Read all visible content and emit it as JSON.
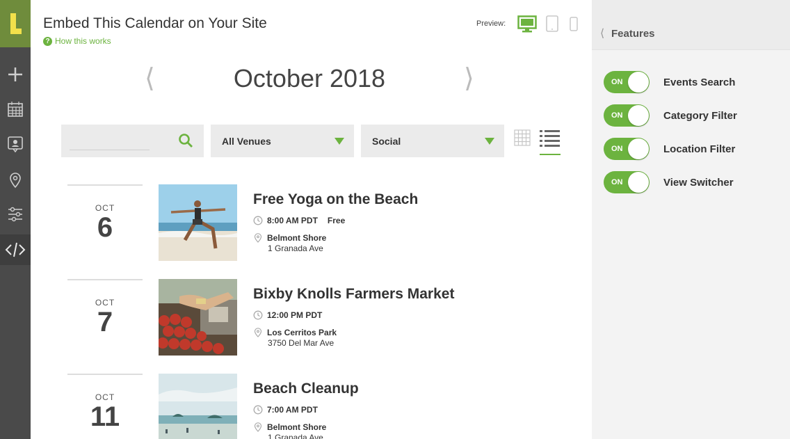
{
  "header": {
    "title": "Embed This Calendar on Your Site",
    "help_link": "How this works",
    "help_icon": "?",
    "preview_label": "Preview:"
  },
  "calendar": {
    "month_label": "October 2018",
    "prev_arrow": "⟨",
    "next_arrow": "⟩"
  },
  "filters": {
    "search_value": "",
    "venue_selected": "All Venues",
    "category_selected": "Social"
  },
  "events": [
    {
      "month": "OCT",
      "day": "6",
      "name": "Free Yoga on the Beach",
      "time": "8:00 AM PDT",
      "price": "Free",
      "venue": "Belmont Shore",
      "address": "1 Granada Ave"
    },
    {
      "month": "OCT",
      "day": "7",
      "name": "Bixby Knolls Farmers Market",
      "time": "12:00 PM PDT",
      "price": "",
      "venue": "Los Cerritos Park",
      "address": "3750 Del Mar Ave"
    },
    {
      "month": "OCT",
      "day": "11",
      "name": "Beach Cleanup",
      "time": "7:00 AM PDT",
      "price": "",
      "venue": "Belmont Shore",
      "address": "1 Granada Ave"
    }
  ],
  "features_panel": {
    "back_arrow": "⟨",
    "title": "Features",
    "toggles": [
      {
        "state": "ON",
        "label": "Events Search"
      },
      {
        "state": "ON",
        "label": "Category Filter"
      },
      {
        "state": "ON",
        "label": "Location Filter"
      },
      {
        "state": "ON",
        "label": "View Switcher"
      }
    ]
  },
  "sidebar": {
    "items": [
      "plus-icon",
      "calendar-icon",
      "profile-card-icon",
      "location-pin-icon",
      "sliders-icon",
      "code-icon"
    ]
  },
  "colors": {
    "accent": "#6cb33f",
    "rail": "#4a4a4a",
    "logo_bg": "#6f8c3c",
    "logo_mark": "#f2e04b"
  }
}
